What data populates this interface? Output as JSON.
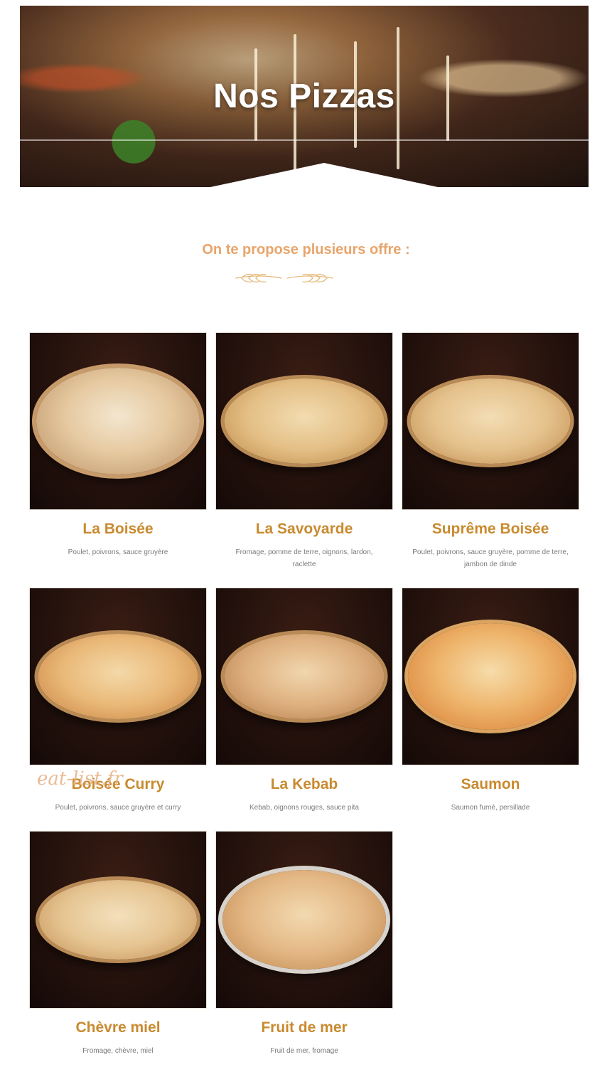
{
  "hero": {
    "title": "Nos Pizzas"
  },
  "intro": {
    "subtitle": "On te propose plusieurs offre :"
  },
  "watermark": "eat-list.fr",
  "pizzas": [
    {
      "name": "La Boisée",
      "desc": "Poulet, poivrons, sauce gruyère"
    },
    {
      "name": "La Savoyarde",
      "desc": "Fromage, pomme de terre, oignons, lardon, raclette"
    },
    {
      "name": "Suprême Boisée",
      "desc": "Poulet, poivrons, sauce gruyère, pomme de terre, jambon de dinde"
    },
    {
      "name": "Boisée Curry",
      "desc": "Poulet, poivrons, sauce gruyère et curry"
    },
    {
      "name": "La Kebab",
      "desc": "Kebab, oignons rouges, sauce pita"
    },
    {
      "name": "Saumon",
      "desc": "Saumon fumé, persillade"
    },
    {
      "name": "Chèvre miel",
      "desc": "Fromage, chèvre, miel"
    },
    {
      "name": "Fruit de mer",
      "desc": "Fruit de mer, fromage"
    }
  ],
  "colors": {
    "accent_subtitle": "#e8a46b",
    "accent_title": "#c98a2f"
  }
}
